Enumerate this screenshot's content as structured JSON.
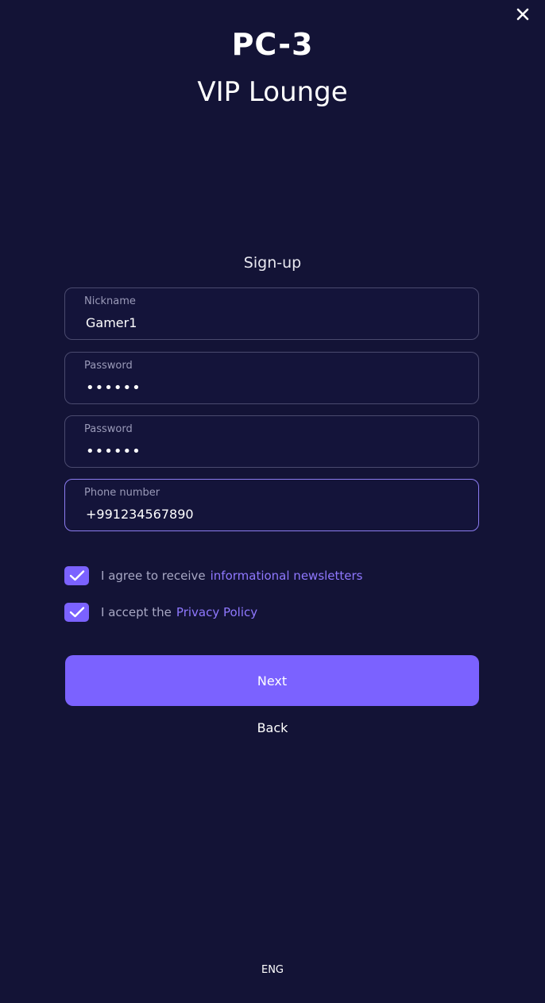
{
  "header": {
    "station": "PC-3",
    "lounge": "VIP Lounge"
  },
  "form": {
    "heading": "Sign-up",
    "fields": [
      {
        "label": "Nickname",
        "value": "Gamer1"
      },
      {
        "label": "Password",
        "value": "••••••"
      },
      {
        "label": "Password",
        "value": "••••••"
      },
      {
        "label": "Phone number",
        "value": "+991234567890"
      }
    ],
    "checkboxes": [
      {
        "text": "I agree to receive",
        "link": "informational newsletters",
        "checked": true
      },
      {
        "text": "I accept the",
        "link": "Privacy Policy",
        "checked": true
      }
    ],
    "next_label": "Next",
    "back_label": "Back"
  },
  "footer": {
    "language": "ENG"
  },
  "colors": {
    "background": "#131336",
    "accent": "#7b62ff",
    "link": "#8f78ff",
    "field_border": "#4a4a6e",
    "focused_border": "#8c7cf0"
  },
  "icons": {
    "close": "close-icon",
    "check": "checkmark-icon"
  }
}
